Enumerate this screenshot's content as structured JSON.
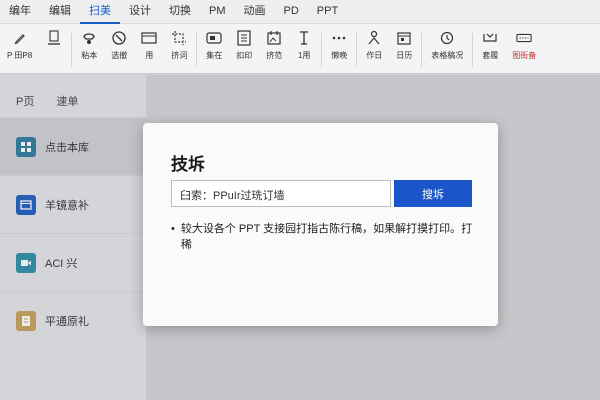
{
  "menubar": {
    "tabs": [
      {
        "label": "编年",
        "active": false
      },
      {
        "label": "编辑",
        "active": false
      },
      {
        "label": "扫美",
        "active": true
      },
      {
        "label": "设计",
        "active": false
      },
      {
        "label": "切换",
        "active": false
      },
      {
        "label": "PM",
        "active": false
      },
      {
        "label": "动画",
        "active": false
      },
      {
        "label": "PD",
        "active": false
      },
      {
        "label": "PPT",
        "active": false
      }
    ]
  },
  "ribbon": {
    "items": [
      {
        "label": "P 田P8",
        "icon": "pen-icon"
      },
      {
        "label": "",
        "icon": "slide-icon"
      },
      {
        "label": "粘本",
        "icon": "paste-icon"
      },
      {
        "label": "选撤",
        "icon": "clock-icon"
      },
      {
        "label": "用",
        "icon": "layout-icon"
      },
      {
        "label": "挤词",
        "icon": "crop-icon"
      },
      {
        "label": "集在",
        "icon": "shape-icon"
      },
      {
        "label": "扣印",
        "icon": "table-icon"
      },
      {
        "label": "挤范",
        "icon": "image-icon"
      },
      {
        "label": "1用",
        "icon": "text-icon"
      },
      {
        "label": "懒晚",
        "icon": "dots-icon"
      },
      {
        "label": "作日",
        "icon": "person-icon"
      },
      {
        "label": "日历",
        "icon": "calendar-icon"
      },
      {
        "label": "表格稿况",
        "icon": "history-icon"
      },
      {
        "label": "套履",
        "icon": "share-icon"
      },
      {
        "label": "图街备",
        "icon": "settings-icon",
        "red": true
      }
    ]
  },
  "leftpanel": {
    "header": [
      "P页",
      "速单"
    ],
    "items": [
      {
        "label": "点击本库",
        "icon": "grid-icon",
        "color": "#2e7d9e"
      },
      {
        "label": "羊镜意补",
        "icon": "window-icon",
        "color": "#1f5fbf"
      },
      {
        "label": "ACI 兴",
        "icon": "video-icon",
        "color": "#2f8fa8"
      },
      {
        "label": "平通原礼",
        "icon": "document-icon",
        "color": "#c8a25a"
      }
    ]
  },
  "dialog": {
    "title": "技坼",
    "search_value": "臼索：PPuIr过珗订墙",
    "search_button": "搜坼",
    "note": "较大设各个 PPT 支接园打指古陈行稿，如果解打摸打印。打稀"
  },
  "colors": {
    "accent": "#1a56c9",
    "active_tab": "#1b5fc4"
  }
}
